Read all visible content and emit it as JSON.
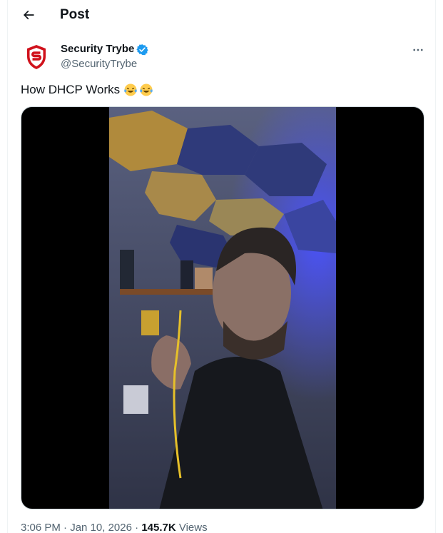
{
  "header": {
    "title": "Post"
  },
  "author": {
    "display_name": "Security Trybe",
    "handle": "@SecurityTrybe",
    "avatar_icon": "shield-s-logo-icon",
    "brand_color": "#d0121c",
    "verified_color": "#1d9bf0"
  },
  "post": {
    "text": "How DHCP Works"
  },
  "meta": {
    "time": "3:06 PM",
    "separator1": " · ",
    "date": "Jan 10, 2026",
    "separator2": " · ",
    "views_count": "145.7K",
    "views_label": " Views"
  }
}
